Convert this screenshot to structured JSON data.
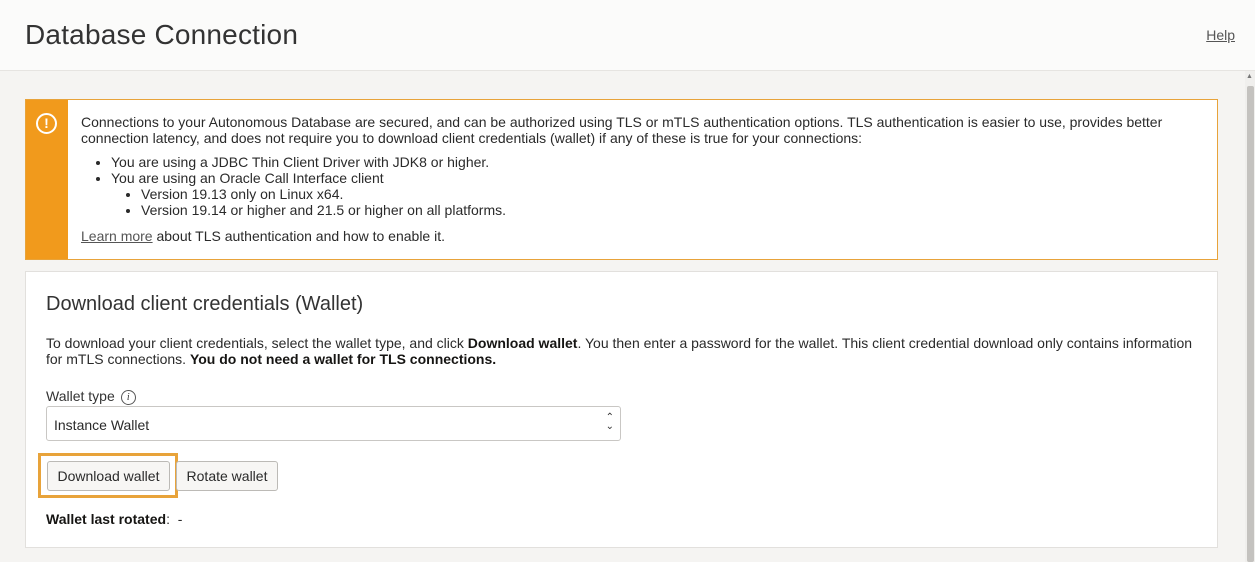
{
  "header": {
    "title": "Database Connection",
    "help_label": "Help"
  },
  "alert": {
    "intro": "Connections to your Autonomous Database are secured, and can be authorized using TLS or mTLS authentication options. TLS authentication is easier to use, provides better connection latency, and does not require you to download client credentials (wallet) if any of these is true for your connections:",
    "items": [
      "You are using a JDBC Thin Client Driver with JDK8 or higher.",
      "You are using an Oracle Call Interface client"
    ],
    "subitems": [
      "Version 19.13 only on Linux x64.",
      "Version 19.14 or higher and 21.5 or higher on all platforms."
    ],
    "learn_more_label": "Learn more",
    "learn_more_suffix": " about TLS authentication and how to enable it."
  },
  "panel": {
    "title": "Download client credentials (Wallet)",
    "desc_part1": "To download your client credentials, select the wallet type, and click ",
    "desc_bold1": "Download wallet",
    "desc_part2": ". You then enter a password for the wallet. This client credential download only contains information for mTLS connections. ",
    "desc_bold2": "You do not need a wallet for TLS connections.",
    "wallet_type_label": "Wallet type",
    "wallet_type_value": "Instance Wallet",
    "download_label": "Download wallet",
    "rotate_label": "Rotate wallet",
    "last_rotated_label": "Wallet last rotated",
    "last_rotated_sep": ":",
    "last_rotated_value": "-"
  },
  "icons": {
    "alert": "warning-circle-icon",
    "info": "info-icon",
    "select": "chevron-up-down-icon"
  },
  "colors": {
    "warning": "#f19a1c",
    "highlight": "#e8a33a"
  }
}
